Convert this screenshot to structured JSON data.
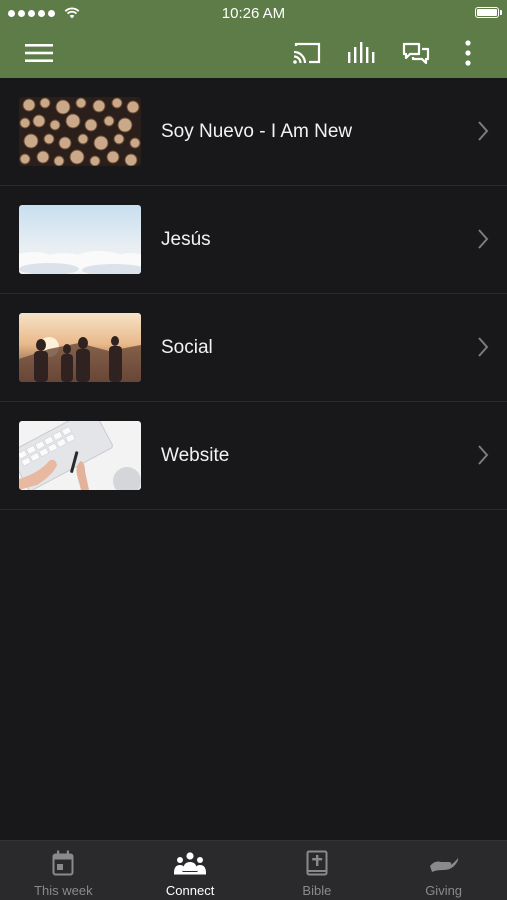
{
  "status_bar": {
    "time": "10:26 AM",
    "battery_level": 1.0
  },
  "colors": {
    "header": "#5e7c47",
    "background": "#18181a",
    "tab_bar": "#2a2a2c",
    "inactive": "#8a8a8d"
  },
  "header": {
    "icons": [
      "menu-icon",
      "cast-icon",
      "audio-bars-icon",
      "chat-icon",
      "more-vert-icon"
    ]
  },
  "items": [
    {
      "label": "Soy Nuevo - I Am New",
      "thumb": "logs-image"
    },
    {
      "label": "Jesús",
      "thumb": "clouds-image"
    },
    {
      "label": "Social",
      "thumb": "friends-image"
    },
    {
      "label": "Website",
      "thumb": "laptop-image"
    }
  ],
  "tabs": [
    {
      "label": "This week",
      "icon": "calendar-icon",
      "active": false
    },
    {
      "label": "Connect",
      "icon": "people-icon",
      "active": true
    },
    {
      "label": "Bible",
      "icon": "bible-icon",
      "active": false
    },
    {
      "label": "Giving",
      "icon": "hand-icon",
      "active": false
    }
  ]
}
